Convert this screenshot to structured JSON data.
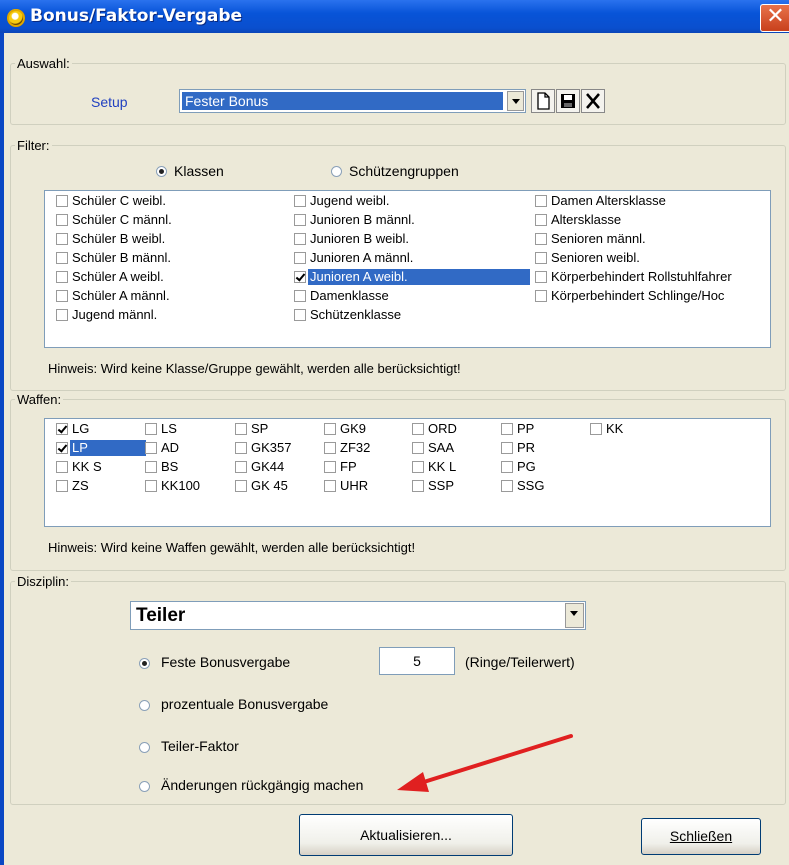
{
  "window": {
    "title": "Bonus/Faktor-Vergabe",
    "close_glyph": "✕"
  },
  "auswahl": {
    "legend": "Auswahl:",
    "setup_label": "Setup",
    "setup_value": "Fester Bonus",
    "icons": [
      "new-document-icon",
      "save-icon",
      "delete-icon"
    ]
  },
  "filter": {
    "legend": "Filter:",
    "radio_klassen": "Klassen",
    "radio_gruppen": "Schützengruppen",
    "selected_mode": "Klassen",
    "classes": [
      [
        "Schüler C weibl.",
        "Schüler C männl.",
        "Schüler B weibl.",
        "Schüler B männl.",
        "Schüler A weibl.",
        "Schüler A männl.",
        "Jugend männl."
      ],
      [
        "Jugend weibl.",
        "Junioren B männl.",
        "Junioren B weibl.",
        "Junioren A männl.",
        "Junioren A weibl.",
        "Damenklasse",
        "Schützenklasse"
      ],
      [
        "Damen Altersklasse",
        "Altersklasse",
        "Senioren männl.",
        "Senioren weibl.",
        "Körperbehindert Rollstuhlfahrer",
        "Körperbehindert Schlinge/Hoc"
      ]
    ],
    "checked": [
      "Junioren A weibl."
    ],
    "hint": "Hinweis: Wird keine Klasse/Gruppe gewählt, werden alle berücksichtigt!"
  },
  "waffen": {
    "legend": "Waffen:",
    "columns": [
      [
        "LG",
        "LP",
        "KK S",
        "ZS"
      ],
      [
        "LS",
        "AD",
        "BS",
        "KK100"
      ],
      [
        "SP",
        "GK357",
        "GK44",
        "GK 45"
      ],
      [
        "GK9",
        "ZF32",
        "FP",
        "UHR"
      ],
      [
        "ORD",
        "SAA",
        "KK L",
        "SSP"
      ],
      [
        "PP",
        "PR",
        "PG",
        "SSG"
      ],
      [
        "KK"
      ]
    ],
    "checked": [
      "LG",
      "LP"
    ],
    "hint": "Hinweis: Wird keine Waffen gewählt, werden alle berücksichtigt!"
  },
  "disziplin": {
    "legend": "Disziplin:",
    "value": "Teiler",
    "opt_feste": "Feste Bonusvergabe",
    "bonus_value": "5",
    "bonus_unit": "(Ringe/Teilerwert)",
    "opt_prozent": "prozentuale Bonusvergabe",
    "opt_teiler": "Teiler-Faktor",
    "opt_undo": "Änderungen rückgängig machen",
    "selected": "Feste Bonusvergabe",
    "arrow_color": "#e02020"
  },
  "buttons": {
    "refresh": "Aktualisieren...",
    "close": "Schließen"
  },
  "colors": {
    "selection": "#316ac5",
    "title_blue": "#0a4fce",
    "dialog_bg": "#ece9d8"
  }
}
